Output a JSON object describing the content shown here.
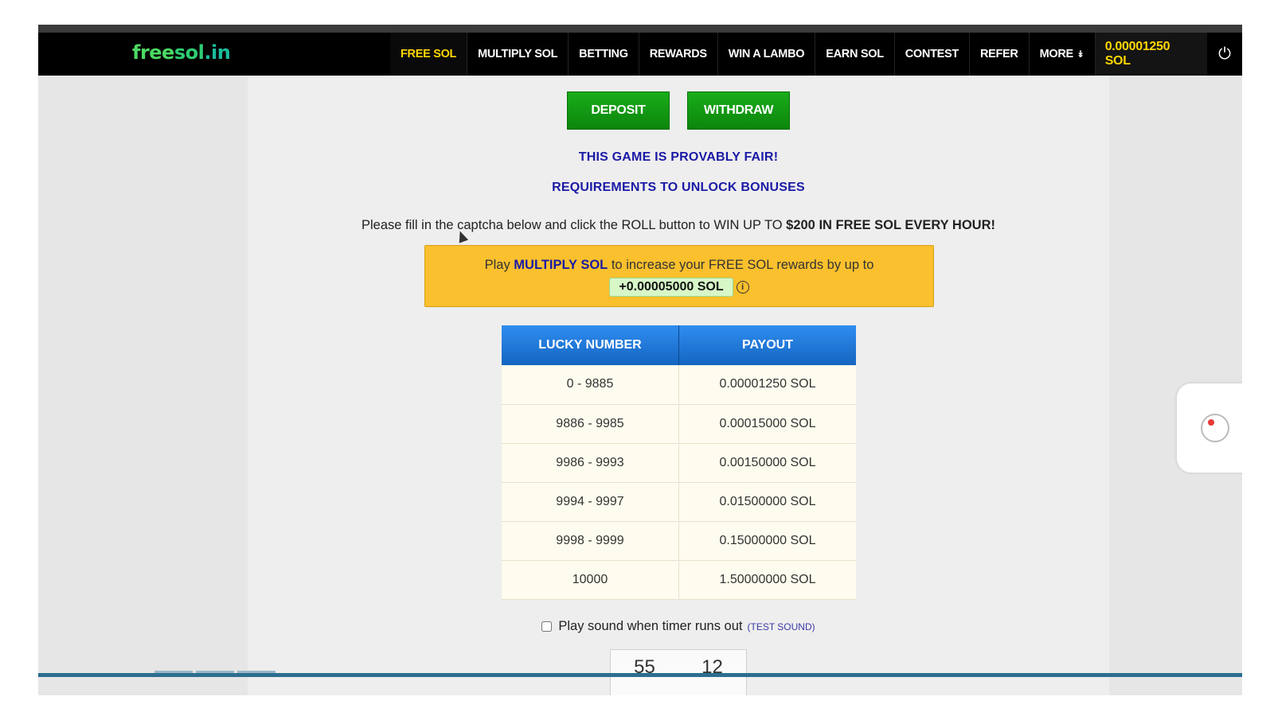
{
  "nav": {
    "logo_parts": [
      "free",
      "sol",
      ".in"
    ],
    "items": [
      {
        "label": "FREE SOL",
        "active": true
      },
      {
        "label": "MULTIPLY SOL",
        "active": false
      },
      {
        "label": "BETTING",
        "active": false
      },
      {
        "label": "REWARDS",
        "active": false
      },
      {
        "label": "WIN A LAMBO",
        "active": false
      },
      {
        "label": "EARN SOL",
        "active": false
      },
      {
        "label": "CONTEST",
        "active": false
      },
      {
        "label": "REFER",
        "active": false
      },
      {
        "label": "MORE",
        "active": false
      }
    ],
    "more_icon": "chevron-double-down-icon",
    "balance": "0.00001250 SOL",
    "power_icon": "power-icon"
  },
  "actions": {
    "deposit_label": "DEPOSIT",
    "withdraw_label": "WITHDRAW"
  },
  "links": {
    "provably_fair": "THIS GAME IS PROVABLY FAIR!",
    "requirements": "REQUIREMENTS TO UNLOCK BONUSES"
  },
  "instruction": {
    "text": "Please fill in the captcha below and click the ROLL button to WIN UP TO ",
    "highlight": "$200 IN FREE SOL EVERY HOUR!"
  },
  "promo": {
    "prefix": "Play ",
    "link": "MULTIPLY SOL",
    "suffix": " to increase your FREE SOL rewards by up to",
    "amount": "+0.00005000 SOL",
    "info_icon": "info-icon"
  },
  "payout_table": {
    "headers": [
      "LUCKY NUMBER",
      "PAYOUT"
    ],
    "rows": [
      [
        "0 - 9885",
        "0.00001250 SOL"
      ],
      [
        "9886 - 9985",
        "0.00015000 SOL"
      ],
      [
        "9986 - 9993",
        "0.00150000 SOL"
      ],
      [
        "9994 - 9997",
        "0.01500000 SOL"
      ],
      [
        "9998 - 9999",
        "0.15000000 SOL"
      ],
      [
        "10000",
        "1.50000000 SOL"
      ]
    ]
  },
  "sound": {
    "label": "Play sound when timer runs out",
    "test_label": "TEST SOUND",
    "checked": false
  },
  "timer": {
    "minutes": "55",
    "seconds": "12"
  },
  "colors": {
    "accent_yellow": "#ffd700",
    "button_green": "#1aad1a",
    "link_blue": "#1a1aa6",
    "promo_bg": "#fbc02d",
    "table_header": "#1e7ad8"
  }
}
